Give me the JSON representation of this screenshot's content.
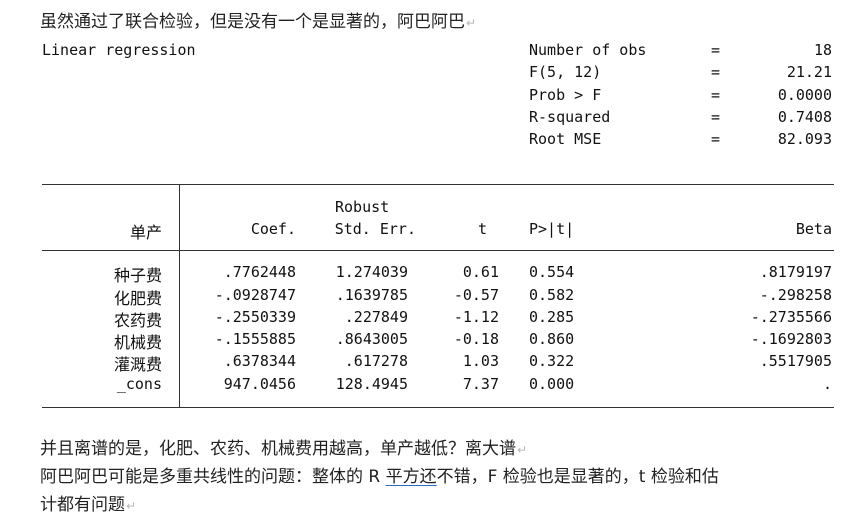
{
  "intro_line": "虽然通过了联合检验，但是没有一个是显著的，阿巴阿巴",
  "para_mark": "↵",
  "regression": {
    "title": "Linear regression",
    "stats": [
      {
        "label": "Number of obs",
        "eq": "=",
        "value": "18"
      },
      {
        "label": "F(5, 12)",
        "eq": "=",
        "value": "21.21"
      },
      {
        "label": "Prob > F",
        "eq": "=",
        "value": "0.0000"
      },
      {
        "label": "R-squared",
        "eq": "=",
        "value": "0.7408"
      },
      {
        "label": "Root MSE",
        "eq": "=",
        "value": "82.093"
      }
    ],
    "header": {
      "depvar": "单产",
      "robust": "Robust",
      "coef": "Coef.",
      "se": "Std. Err.",
      "t": "t",
      "p": "P>|t|",
      "beta": "Beta"
    },
    "rows": [
      {
        "name": "种子费",
        "coef": ".7762448",
        "se": "1.274039",
        "t": "0.61",
        "p": "0.554",
        "beta": ".8179197"
      },
      {
        "name": "化肥费",
        "coef": "-.0928747",
        "se": ".1639785",
        "t": "-0.57",
        "p": "0.582",
        "beta": "-.298258"
      },
      {
        "name": "农药费",
        "coef": "-.2550339",
        "se": ".227849",
        "t": "-1.12",
        "p": "0.285",
        "beta": "-.2735566"
      },
      {
        "name": "机械费",
        "coef": "-.1555885",
        "se": ".8643005",
        "t": "-0.18",
        "p": "0.860",
        "beta": "-.1692803"
      },
      {
        "name": "灌溉费",
        "coef": ".6378344",
        "se": ".617278",
        "t": "1.03",
        "p": "0.322",
        "beta": ".5517905"
      },
      {
        "name": "_cons",
        "coef": "947.0456",
        "se": "128.4945",
        "t": "7.37",
        "p": "0.000",
        "beta": "."
      }
    ]
  },
  "para2": "并且离谱的是，化肥、农药、机械费用越高，单产越低？离大谱",
  "para3": {
    "a": "阿巴阿巴可能是多重共线性的问题：整体的 R ",
    "b": "平方还",
    "c": "不错，F 检验也是显著的，t 检验和估",
    "d": "计都有问题"
  }
}
